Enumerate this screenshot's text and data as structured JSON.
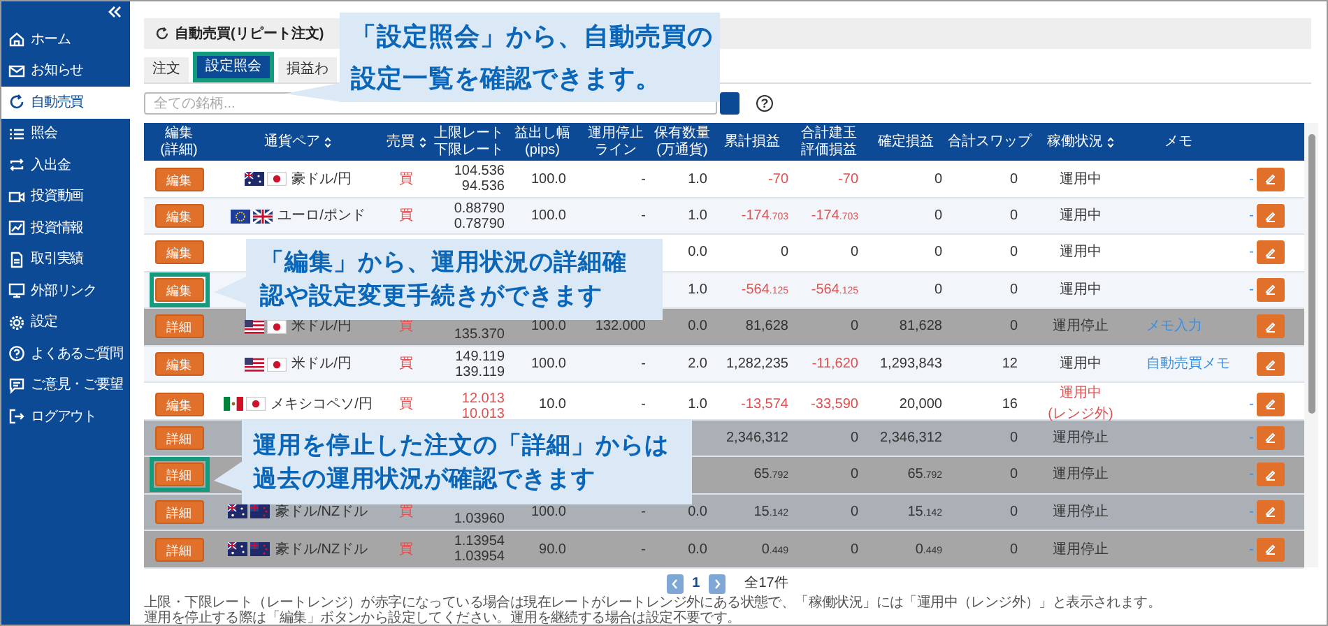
{
  "sidebar": {
    "items": [
      {
        "label": "ホーム",
        "selected": false
      },
      {
        "label": "お知らせ",
        "selected": false
      },
      {
        "label": "自動売買",
        "selected": true
      },
      {
        "label": "照会",
        "selected": false
      },
      {
        "label": "入出金",
        "selected": false
      },
      {
        "label": "投資動画",
        "selected": false
      },
      {
        "label": "投資情報",
        "selected": false
      },
      {
        "label": "取引実績",
        "selected": false
      },
      {
        "label": "外部リンク",
        "selected": false
      },
      {
        "label": "設定",
        "selected": false
      },
      {
        "label": "よくあるご質問",
        "selected": false
      },
      {
        "label": "ご意見・ご要望",
        "selected": false
      },
      {
        "label": "ログアウト",
        "selected": false
      }
    ]
  },
  "page_title": "自動売買(リピート注文)",
  "tabs": [
    {
      "label": "注文",
      "selected": false,
      "highlighted": false
    },
    {
      "label": "設定照会",
      "selected": true,
      "highlighted": true
    },
    {
      "label": "損益わ",
      "selected": false,
      "highlighted": false
    }
  ],
  "search": {
    "placeholder": "全ての銘柄..."
  },
  "help_label": "?",
  "table": {
    "columns": [
      {
        "lines": [
          "編集",
          "(詳細)"
        ],
        "sortable": false
      },
      {
        "lines": [
          "通貨ペア"
        ],
        "sortable": true
      },
      {
        "lines": [
          "売買"
        ],
        "sortable": true
      },
      {
        "lines": [
          "上限レート",
          "下限レート"
        ],
        "sortable": false
      },
      {
        "lines": [
          "益出し幅",
          "(pips)"
        ],
        "sortable": false
      },
      {
        "lines": [
          "運用停止",
          "ライン"
        ],
        "sortable": false
      },
      {
        "lines": [
          "保有数量",
          "(万通貨)"
        ],
        "sortable": false
      },
      {
        "lines": [
          "累計損益"
        ],
        "sortable": false
      },
      {
        "lines": [
          "合計建玉",
          "評価損益"
        ],
        "sortable": false
      },
      {
        "lines": [
          "確定損益"
        ],
        "sortable": false
      },
      {
        "lines": [
          "合計スワップ"
        ],
        "sortable": false
      },
      {
        "lines": [
          "稼働状況"
        ],
        "sortable": true
      },
      {
        "lines": [
          "メモ"
        ],
        "sortable": false
      }
    ],
    "rows": [
      {
        "button": "編集",
        "stopped": false,
        "highlighted": false,
        "flags": [
          {
            "kind": "au"
          },
          {
            "kind": "jp"
          }
        ],
        "pair": "豪ドル/円",
        "side": "買",
        "rate_upper": "104.536",
        "rate_lower": "94.536",
        "out_of_range": false,
        "pips": "100.0",
        "stop_line": "-",
        "quantity": "1.0",
        "cumulative": {
          "text": "-70",
          "loss": true
        },
        "unrealized": {
          "text": "-70",
          "loss": true
        },
        "realized": "0",
        "swap": "0",
        "status": "運用中",
        "memo": {
          "text": "-",
          "kind": "dash"
        }
      },
      {
        "button": "編集",
        "stopped": false,
        "highlighted": false,
        "flags": [
          {
            "kind": "eu"
          },
          {
            "kind": "gb"
          }
        ],
        "pair": "ユーロ/ポンド",
        "side": "買",
        "rate_upper": "0.88790",
        "rate_lower": "0.78790",
        "out_of_range": false,
        "pips": "100.0",
        "stop_line": "-",
        "quantity": "1.0",
        "cumulative": {
          "text": "-174.703",
          "loss": true
        },
        "unrealized": {
          "text": "-174.703",
          "loss": true
        },
        "realized": "0",
        "swap": "0",
        "status": "運用中",
        "memo": {
          "text": "-",
          "kind": "dash"
        }
      },
      {
        "button": "編集",
        "stopped": false,
        "highlighted": false,
        "quantity": "0.0",
        "out_of_range": false,
        "cumulative": {
          "text": "0",
          "loss": false
        },
        "unrealized": {
          "text": "0",
          "loss": false
        },
        "realized": "0",
        "swap": "0",
        "status": "運用中",
        "memo": {
          "text": "-",
          "kind": "dash"
        }
      },
      {
        "button": "編集",
        "stopped": false,
        "highlighted": true,
        "quantity": "1.0",
        "out_of_range": false,
        "cumulative": {
          "text": "-564.125",
          "loss": true
        },
        "unrealized": {
          "text": "-564.125",
          "loss": true
        },
        "realized": "0",
        "swap": "0",
        "status": "運用中",
        "memo": {
          "text": "-",
          "kind": "dash"
        }
      },
      {
        "button": "詳細",
        "stopped": true,
        "highlighted": false,
        "flags": [
          {
            "kind": "us"
          },
          {
            "kind": "jp"
          }
        ],
        "pair": "米ドル/円",
        "side": "買",
        "rate_lower": "135.370",
        "out_of_range": false,
        "pips": "100.0",
        "stop_line": "132.000",
        "quantity": "0.0",
        "cumulative": {
          "text": "81,628",
          "loss": false
        },
        "unrealized": {
          "text": "0",
          "loss": false
        },
        "realized": "81,628",
        "swap": "0",
        "status": "運用停止",
        "memo": {
          "text": "メモ入力",
          "kind": "link"
        }
      },
      {
        "button": "編集",
        "stopped": false,
        "highlighted": false,
        "flags": [
          {
            "kind": "us"
          },
          {
            "kind": "jp"
          }
        ],
        "pair": "米ドル/円",
        "side": "買",
        "rate_upper": "149.119",
        "rate_lower": "139.119",
        "out_of_range": false,
        "pips": "100.0",
        "stop_line": "-",
        "quantity": "2.0",
        "cumulative": {
          "text": "1,282,235",
          "loss": false
        },
        "unrealized": {
          "text": "-11,620",
          "loss": true
        },
        "realized": "1,293,843",
        "swap": "12",
        "status": "運用中",
        "memo": {
          "text": "自動売買メモ",
          "kind": "link"
        }
      },
      {
        "button": "編集",
        "stopped": false,
        "highlighted": false,
        "flags": [
          {
            "kind": "mx"
          },
          {
            "kind": "jp"
          }
        ],
        "pair": "メキシコペソ/円",
        "side": "買",
        "rate_upper": "12.013",
        "rate_lower": "10.013",
        "out_of_range": true,
        "pips": "10.0",
        "stop_line": "-",
        "quantity": "1.0",
        "cumulative": {
          "text": "-13,574",
          "loss": true
        },
        "unrealized": {
          "text": "-33,590",
          "loss": true
        },
        "realized": "20,000",
        "swap": "16",
        "status": "運用中",
        "status_note": "(レンジ外)",
        "memo": {
          "text": "-",
          "kind": "dash"
        }
      },
      {
        "button": "詳細",
        "stopped": true,
        "highlighted": false,
        "out_of_range": false,
        "cumulative": {
          "text": "2,346,312",
          "loss": false
        },
        "unrealized": {
          "text": "0",
          "loss": false
        },
        "realized": "2,346,312",
        "swap": "0",
        "status": "運用停止",
        "memo": {
          "text": "-",
          "kind": "dash"
        }
      },
      {
        "button": "詳細",
        "stopped": true,
        "highlighted": true,
        "out_of_range": false,
        "cumulative": {
          "text": "65.792",
          "loss": false
        },
        "unrealized": {
          "text": "0",
          "loss": false
        },
        "realized": "65.792",
        "swap": "0",
        "status": "運用停止",
        "memo": {
          "text": "-",
          "kind": "dash"
        }
      },
      {
        "button": "詳細",
        "stopped": true,
        "highlighted": false,
        "flags": [
          {
            "kind": "au"
          },
          {
            "kind": "nz"
          }
        ],
        "pair": "豪ドル/NZドル",
        "side": "買",
        "rate_lower": "1.03960",
        "out_of_range": false,
        "pips": "100.0",
        "stop_line": "-",
        "quantity": "0.0",
        "cumulative": {
          "text": "15.142",
          "loss": false
        },
        "unrealized": {
          "text": "0",
          "loss": false
        },
        "realized": "15.142",
        "swap": "0",
        "status": "運用停止",
        "memo": {
          "text": "-",
          "kind": "dash"
        }
      },
      {
        "button": "詳細",
        "stopped": true,
        "highlighted": false,
        "flags": [
          {
            "kind": "au"
          },
          {
            "kind": "nz"
          }
        ],
        "pair": "豪ドル/NZドル",
        "side": "買",
        "rate_upper": "1.13954",
        "rate_lower": "1.03954",
        "out_of_range": false,
        "pips": "90.0",
        "stop_line": "-",
        "quantity": "0.0",
        "cumulative": {
          "text": "0.449",
          "loss": false
        },
        "unrealized": {
          "text": "0",
          "loss": false
        },
        "realized": "0.449",
        "swap": "0",
        "status": "運用停止",
        "memo": {
          "text": "-",
          "kind": "dash"
        }
      }
    ]
  },
  "pagination": {
    "current": "1",
    "total": "全17件"
  },
  "notes": [
    "上限・下限レート（レートレンジ）が赤字になっている場合は現在レートがレートレンジ外にある状態で、「稼働状況」には「運用中（レンジ外）」と表示されます。",
    "運用を停止する際は「編集」ボタンから設定してください。運用を継続する場合は設定不要です。"
  ],
  "callouts": [
    {
      "lines": [
        "「設定照会」から、自動売買の",
        "設定一覧を確認できます。"
      ]
    },
    {
      "lines": [
        "「編集」から、運用状況の詳細確",
        "認や設定変更手続きができます"
      ]
    },
    {
      "lines": [
        "運用を停止した注文の「詳細」からは",
        "過去の運用状況が確認できます"
      ]
    }
  ]
}
